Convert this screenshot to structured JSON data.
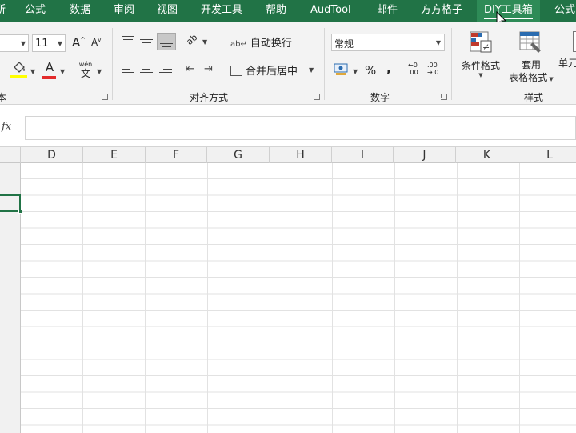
{
  "tabs": [
    "所",
    "公式",
    "数据",
    "审阅",
    "视图",
    "开发工具",
    "帮助",
    "AudTool",
    "邮件",
    "方方格子",
    "DIY工具箱",
    "公式"
  ],
  "active_tab_index": 10,
  "ribbon": {
    "font": {
      "size_value": "11",
      "grow_font_icon": "A",
      "shrink_font_icon": "A",
      "fill_color_letter": "",
      "font_color_letter": "A",
      "phonetic_top": "wén",
      "phonetic_bottom": "文",
      "group_label": "本"
    },
    "alignment": {
      "orientation_letters": "ab",
      "wrap_text": "自动换行",
      "merge_center": "合并后居中",
      "group_label": "对齐方式"
    },
    "number": {
      "format_value": "常规",
      "percent": "%",
      "comma": ",",
      "increase_decimal_top": "←0",
      "increase_decimal_bottom": ".00",
      "decrease_decimal_top": ".00",
      "decrease_decimal_bottom": "→.0",
      "group_label": "数字"
    },
    "styles": {
      "conditional_format": "条件格式",
      "table_format_top": "套用",
      "table_format_bottom": "表格格式",
      "cell_styles": "单元",
      "group_label": "样式"
    }
  },
  "formula_bar": {
    "fx": "fx",
    "value": ""
  },
  "columns": [
    "D",
    "E",
    "F",
    "G",
    "H",
    "I",
    "J",
    "K",
    "L"
  ],
  "colors": {
    "accent": "#217346",
    "active_tab": "#2e8b57",
    "font_color_bar": "#e32b2b",
    "fill_color_bar": "#ffff00"
  },
  "icons": {
    "fill_color": "paint-bucket-icon",
    "conditional_format": "conditional-format-icon",
    "table_format": "table-format-icon",
    "accounting": "accounting-format-icon",
    "cursor": "mouse-cursor-icon"
  }
}
